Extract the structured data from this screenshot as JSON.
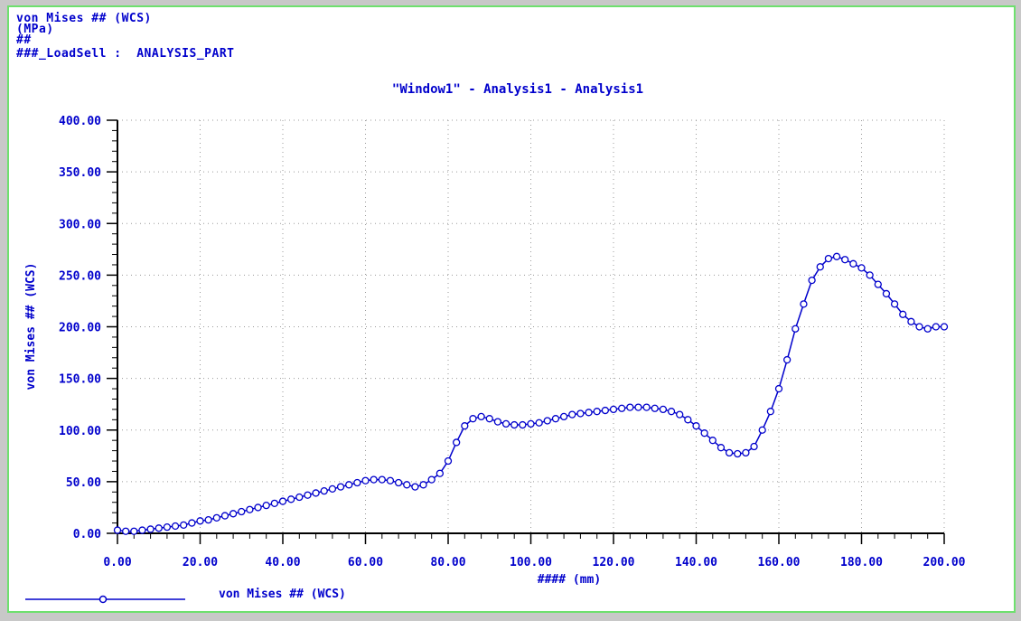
{
  "header": {
    "line1": "von Mises ## (WCS)",
    "line2": "(MPa)",
    "line3": "##",
    "line4": "###_LoadSell :  ANALYSIS_PART"
  },
  "chart_data": {
    "type": "line",
    "title": "\"Window1\" - Analysis1 - Analysis1",
    "xlabel": "#### (mm)",
    "ylabel": "von Mises ## (WCS)",
    "xlim": [
      0,
      200
    ],
    "ylim": [
      0,
      400
    ],
    "x_ticks": [
      "0.00",
      "20.00",
      "40.00",
      "60.00",
      "80.00",
      "100.00",
      "120.00",
      "140.00",
      "160.00",
      "180.00",
      "200.00"
    ],
    "y_ticks": [
      "0.00",
      "50.00",
      "100.00",
      "150.00",
      "200.00",
      "250.00",
      "300.00",
      "350.00",
      "400.00"
    ],
    "grid": true,
    "color": "#0000cc",
    "series": [
      {
        "name": "von Mises ## (WCS)",
        "x": [
          0,
          2,
          4,
          6,
          8,
          10,
          12,
          14,
          16,
          18,
          20,
          22,
          24,
          26,
          28,
          30,
          32,
          34,
          36,
          38,
          40,
          42,
          44,
          46,
          48,
          50,
          52,
          54,
          56,
          58,
          60,
          62,
          64,
          66,
          68,
          70,
          72,
          74,
          76,
          78,
          80,
          82,
          84,
          86,
          88,
          90,
          92,
          94,
          96,
          98,
          100,
          102,
          104,
          106,
          108,
          110,
          112,
          114,
          116,
          118,
          120,
          122,
          124,
          126,
          128,
          130,
          132,
          134,
          136,
          138,
          140,
          142,
          144,
          146,
          148,
          150,
          152,
          154,
          156,
          158,
          160,
          162,
          164,
          166,
          168,
          170,
          172,
          174,
          176,
          178,
          180,
          182,
          184,
          186,
          188,
          190,
          192,
          194,
          196,
          198,
          200
        ],
        "y": [
          3,
          2,
          2,
          3,
          4,
          5,
          6,
          7,
          8,
          10,
          12,
          13,
          15,
          17,
          19,
          21,
          23,
          25,
          27,
          29,
          31,
          33,
          35,
          37,
          39,
          41,
          43,
          45,
          47,
          49,
          51,
          52,
          52,
          51,
          49,
          47,
          45,
          47,
          52,
          58,
          70,
          88,
          104,
          111,
          113,
          111,
          108,
          106,
          105,
          105,
          106,
          107,
          109,
          111,
          113,
          115,
          116,
          117,
          118,
          119,
          120,
          121,
          122,
          122,
          122,
          121,
          120,
          118,
          115,
          110,
          104,
          97,
          90,
          83,
          78,
          77,
          78,
          84,
          100,
          118,
          140,
          168,
          198,
          222,
          245,
          258,
          266,
          268,
          265,
          261,
          257,
          250,
          241,
          232,
          222,
          212,
          205,
          200,
          198,
          200,
          200
        ]
      }
    ]
  }
}
